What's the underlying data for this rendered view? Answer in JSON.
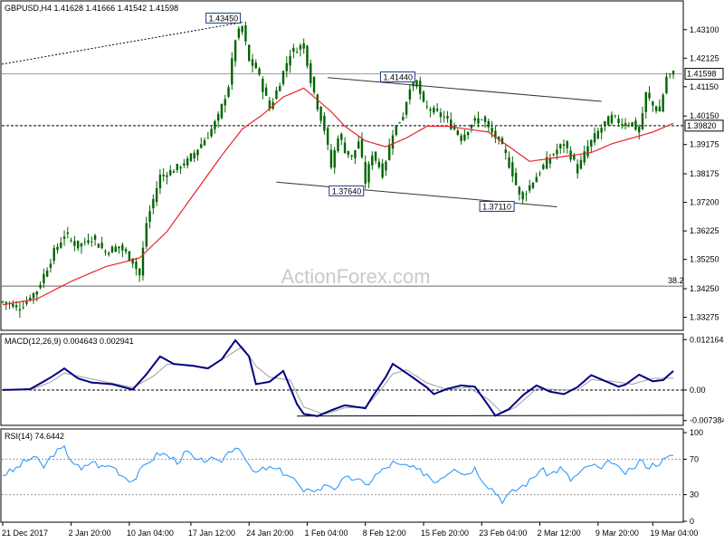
{
  "chart_data": [
    {
      "type": "candlestick",
      "title": "GBPUSD,H4  1.41628 1.41666 1.41542 1.41598",
      "ylim": [
        1.3289,
        1.4402
      ],
      "y_ticks": [
        "1.43100",
        "1.42125",
        "1.41150",
        "1.40150",
        "1.39175",
        "1.38175",
        "1.37200",
        "1.36225",
        "1.35250",
        "1.34250",
        "1.33275"
      ],
      "last_price": "1.41598",
      "level_lines": [
        {
          "value": 1.3982,
          "label": "1.39820"
        },
        {
          "value": 1.4159,
          "label": ""
        }
      ],
      "fib": {
        "value": 1.3434,
        "label": "38.2"
      },
      "annotations": [
        {
          "label": "1.43450",
          "value": 1.4345,
          "index": 70
        },
        {
          "label": "1.41440",
          "value": 1.4144,
          "index": 121
        },
        {
          "label": "1.37640",
          "value": 1.3764,
          "index": 106
        },
        {
          "label": "1.37110",
          "value": 1.3711,
          "index": 150
        }
      ],
      "price_anchors": [
        [
          0,
          1.338
        ],
        [
          5,
          1.336
        ],
        [
          10,
          1.342
        ],
        [
          15,
          1.355
        ],
        [
          18,
          1.361
        ],
        [
          22,
          1.357
        ],
        [
          26,
          1.36
        ],
        [
          30,
          1.355
        ],
        [
          34,
          1.357
        ],
        [
          38,
          1.352
        ],
        [
          40,
          1.347
        ],
        [
          42,
          1.365
        ],
        [
          46,
          1.381
        ],
        [
          50,
          1.383
        ],
        [
          54,
          1.386
        ],
        [
          58,
          1.392
        ],
        [
          60,
          1.395
        ],
        [
          63,
          1.401
        ],
        [
          66,
          1.412
        ],
        [
          68,
          1.428
        ],
        [
          70,
          1.432
        ],
        [
          72,
          1.42
        ],
        [
          74,
          1.418
        ],
        [
          76,
          1.411
        ],
        [
          78,
          1.404
        ],
        [
          80,
          1.41
        ],
        [
          84,
          1.423
        ],
        [
          88,
          1.426
        ],
        [
          90,
          1.414
        ],
        [
          92,
          1.405
        ],
        [
          94,
          1.397
        ],
        [
          96,
          1.384
        ],
        [
          98,
          1.395
        ],
        [
          100,
          1.39
        ],
        [
          102,
          1.387
        ],
        [
          104,
          1.393
        ],
        [
          106,
          1.379
        ],
        [
          108,
          1.389
        ],
        [
          111,
          1.382
        ],
        [
          114,
          1.396
        ],
        [
          117,
          1.402
        ],
        [
          119,
          1.412
        ],
        [
          121,
          1.413
        ],
        [
          123,
          1.405
        ],
        [
          126,
          1.403
        ],
        [
          129,
          1.401
        ],
        [
          132,
          1.397
        ],
        [
          134,
          1.394
        ],
        [
          137,
          1.399
        ],
        [
          140,
          1.401
        ],
        [
          142,
          1.397
        ],
        [
          145,
          1.393
        ],
        [
          147,
          1.388
        ],
        [
          149,
          1.382
        ],
        [
          151,
          1.374
        ],
        [
          153,
          1.376
        ],
        [
          156,
          1.381
        ],
        [
          159,
          1.386
        ],
        [
          162,
          1.39
        ],
        [
          164,
          1.392
        ],
        [
          166,
          1.388
        ],
        [
          168,
          1.383
        ],
        [
          171,
          1.391
        ],
        [
          174,
          1.396
        ],
        [
          176,
          1.399
        ],
        [
          178,
          1.401
        ],
        [
          181,
          1.399
        ],
        [
          184,
          1.399
        ],
        [
          186,
          1.396
        ],
        [
          188,
          1.409
        ],
        [
          190,
          1.405
        ],
        [
          192,
          1.403
        ],
        [
          194,
          1.415
        ],
        [
          196,
          1.416
        ]
      ],
      "ma_anchors": [
        [
          0,
          1.337
        ],
        [
          10,
          1.339
        ],
        [
          20,
          1.345
        ],
        [
          30,
          1.35
        ],
        [
          40,
          1.353
        ],
        [
          48,
          1.362
        ],
        [
          56,
          1.375
        ],
        [
          64,
          1.388
        ],
        [
          70,
          1.397
        ],
        [
          76,
          1.402
        ],
        [
          82,
          1.408
        ],
        [
          88,
          1.411
        ],
        [
          92,
          1.407
        ],
        [
          96,
          1.403
        ],
        [
          100,
          1.398
        ],
        [
          106,
          1.393
        ],
        [
          112,
          1.391
        ],
        [
          118,
          1.394
        ],
        [
          124,
          1.398
        ],
        [
          130,
          1.398
        ],
        [
          136,
          1.397
        ],
        [
          142,
          1.396
        ],
        [
          148,
          1.391
        ],
        [
          154,
          1.386
        ],
        [
          160,
          1.387
        ],
        [
          166,
          1.388
        ],
        [
          172,
          1.389
        ],
        [
          178,
          1.392
        ],
        [
          184,
          1.394
        ],
        [
          190,
          1.396
        ],
        [
          196,
          1.399
        ]
      ],
      "channels": [
        {
          "from": [
            95,
            1.4146
          ],
          "to": [
            175,
            1.4065
          ]
        },
        {
          "from": [
            80,
            1.3789
          ],
          "to": [
            162,
            1.3705
          ]
        }
      ],
      "x_ticks": [
        {
          "index": 0,
          "label": "21 Dec 2017"
        },
        {
          "index": 20,
          "label": "2 Jan 20:00"
        },
        {
          "index": 37,
          "label": "10 Jan 04:00"
        },
        {
          "index": 55,
          "label": "17 Jan 12:00"
        },
        {
          "index": 72,
          "label": "24 Jan 20:00"
        },
        {
          "index": 89,
          "label": "1 Feb 04:00"
        },
        {
          "index": 106,
          "label": "8 Feb 12:00"
        },
        {
          "index": 123,
          "label": "15 Feb 20:00"
        },
        {
          "index": 140,
          "label": "23 Feb 04:00"
        },
        {
          "index": 157,
          "label": "2 Mar 12:00"
        },
        {
          "index": 174,
          "label": "9 Mar 20:00"
        },
        {
          "index": 190,
          "label": "19 Mar 04:00"
        }
      ]
    },
    {
      "type": "line",
      "title": "MACD(12,26,9) 0.004643 0.002941",
      "ylim": [
        -0.0081,
        0.0131
      ],
      "y_ticks": [
        "0.012164",
        "0.00",
        "-0.007384"
      ],
      "macd_anchors": [
        [
          0,
          0.0
        ],
        [
          8,
          0.0002
        ],
        [
          14,
          0.003
        ],
        [
          18,
          0.0052
        ],
        [
          22,
          0.0028
        ],
        [
          26,
          0.0018
        ],
        [
          32,
          0.0014
        ],
        [
          38,
          0.0001
        ],
        [
          42,
          0.0038
        ],
        [
          46,
          0.0081
        ],
        [
          50,
          0.0063
        ],
        [
          56,
          0.0058
        ],
        [
          60,
          0.0052
        ],
        [
          64,
          0.0074
        ],
        [
          68,
          0.012
        ],
        [
          72,
          0.0081
        ],
        [
          74,
          0.0014
        ],
        [
          78,
          0.002
        ],
        [
          82,
          0.0046
        ],
        [
          86,
          -0.0034
        ],
        [
          88,
          -0.0058
        ],
        [
          92,
          -0.0063
        ],
        [
          96,
          -0.0049
        ],
        [
          100,
          -0.0037
        ],
        [
          106,
          -0.0044
        ],
        [
          108,
          -0.0017
        ],
        [
          112,
          0.0032
        ],
        [
          114,
          0.0063
        ],
        [
          118,
          0.0041
        ],
        [
          124,
          0.0006
        ],
        [
          126,
          -0.001
        ],
        [
          130,
          0.0003
        ],
        [
          134,
          0.0011
        ],
        [
          138,
          0.0008
        ],
        [
          142,
          -0.0038
        ],
        [
          144,
          -0.0062
        ],
        [
          148,
          -0.0046
        ],
        [
          152,
          -0.0013
        ],
        [
          156,
          0.0011
        ],
        [
          160,
          -0.0004
        ],
        [
          164,
          -0.001
        ],
        [
          168,
          0.0007
        ],
        [
          172,
          0.0036
        ],
        [
          176,
          0.0022
        ],
        [
          180,
          0.0008
        ],
        [
          182,
          0.0013
        ],
        [
          186,
          0.0037
        ],
        [
          190,
          0.0021
        ],
        [
          193,
          0.0024
        ],
        [
          196,
          0.0046
        ]
      ],
      "signal_anchors": [
        [
          0,
          0.0
        ],
        [
          8,
          0.0
        ],
        [
          14,
          0.0019
        ],
        [
          18,
          0.0041
        ],
        [
          24,
          0.003
        ],
        [
          30,
          0.002
        ],
        [
          38,
          0.0006
        ],
        [
          44,
          0.0033
        ],
        [
          48,
          0.0062
        ],
        [
          54,
          0.0061
        ],
        [
          60,
          0.0054
        ],
        [
          66,
          0.0083
        ],
        [
          70,
          0.0105
        ],
        [
          74,
          0.0058
        ],
        [
          78,
          0.0031
        ],
        [
          84,
          0.0024
        ],
        [
          88,
          -0.0041
        ],
        [
          94,
          -0.0059
        ],
        [
          100,
          -0.0043
        ],
        [
          106,
          -0.0041
        ],
        [
          110,
          -0.0005
        ],
        [
          114,
          0.0039
        ],
        [
          118,
          0.0049
        ],
        [
          124,
          0.0017
        ],
        [
          130,
          0.0001
        ],
        [
          136,
          0.0007
        ],
        [
          142,
          -0.0023
        ],
        [
          146,
          -0.0056
        ],
        [
          150,
          -0.0041
        ],
        [
          156,
          0.0003
        ],
        [
          162,
          0.0001
        ],
        [
          168,
          0.0
        ],
        [
          172,
          0.0025
        ],
        [
          178,
          0.0021
        ],
        [
          184,
          0.0014
        ],
        [
          190,
          0.0028
        ],
        [
          196,
          0.0029
        ]
      ],
      "trend": {
        "from": [
          86,
          -0.0063
        ],
        "to": [
          196,
          -0.0061
        ]
      }
    },
    {
      "type": "line",
      "title": "RSI(14) 74.6442",
      "ylim": [
        0,
        100
      ],
      "y_ticks": [
        "100",
        "70",
        "30",
        "0"
      ],
      "guides": [
        70,
        30
      ],
      "rsi_anchors": [
        [
          0,
          53
        ],
        [
          3,
          57
        ],
        [
          6,
          66
        ],
        [
          9,
          73
        ],
        [
          12,
          61
        ],
        [
          15,
          77
        ],
        [
          18,
          82
        ],
        [
          20,
          70
        ],
        [
          23,
          57
        ],
        [
          26,
          68
        ],
        [
          29,
          61
        ],
        [
          32,
          63
        ],
        [
          35,
          52
        ],
        [
          38,
          46
        ],
        [
          40,
          55
        ],
        [
          43,
          69
        ],
        [
          46,
          77
        ],
        [
          48,
          74
        ],
        [
          51,
          68
        ],
        [
          54,
          78
        ],
        [
          57,
          66
        ],
        [
          60,
          71
        ],
        [
          63,
          65
        ],
        [
          66,
          78
        ],
        [
          68,
          85
        ],
        [
          70,
          80
        ],
        [
          72,
          60
        ],
        [
          74,
          54
        ],
        [
          77,
          60
        ],
        [
          80,
          58
        ],
        [
          83,
          54
        ],
        [
          86,
          44
        ],
        [
          88,
          30
        ],
        [
          90,
          38
        ],
        [
          92,
          35
        ],
        [
          95,
          42
        ],
        [
          97,
          38
        ],
        [
          100,
          47
        ],
        [
          103,
          49
        ],
        [
          106,
          40
        ],
        [
          109,
          52
        ],
        [
          112,
          60
        ],
        [
          114,
          66
        ],
        [
          116,
          62
        ],
        [
          118,
          63
        ],
        [
          121,
          57
        ],
        [
          124,
          54
        ],
        [
          126,
          45
        ],
        [
          129,
          52
        ],
        [
          132,
          62
        ],
        [
          135,
          53
        ],
        [
          138,
          60
        ],
        [
          141,
          44
        ],
        [
          144,
          33
        ],
        [
          146,
          24
        ],
        [
          148,
          30
        ],
        [
          151,
          38
        ],
        [
          154,
          45
        ],
        [
          157,
          58
        ],
        [
          160,
          53
        ],
        [
          163,
          60
        ],
        [
          166,
          47
        ],
        [
          169,
          55
        ],
        [
          172,
          64
        ],
        [
          175,
          58
        ],
        [
          178,
          69
        ],
        [
          181,
          54
        ],
        [
          184,
          57
        ],
        [
          186,
          68
        ],
        [
          189,
          62
        ],
        [
          192,
          67
        ],
        [
          194,
          70
        ],
        [
          196,
          75
        ]
      ]
    }
  ],
  "watermark": "ActionForex.com",
  "colors": {
    "candle": "#006400",
    "ma": "#e8232a",
    "macd": "#000080",
    "signal": "#a0a0a0",
    "rsi": "#1e90ff",
    "grid": "#bbbbbb",
    "label_box": "#1a3a8a"
  }
}
